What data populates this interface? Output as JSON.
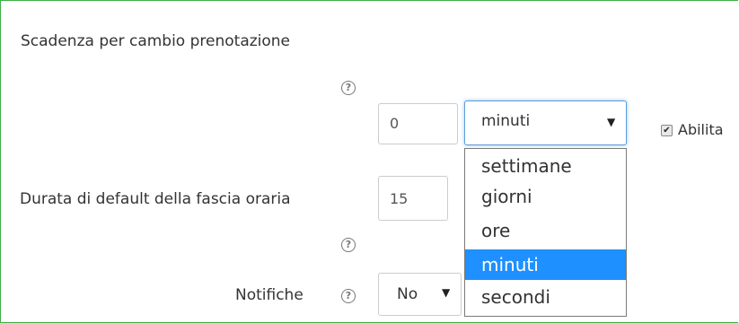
{
  "form": {
    "booking_change_deadline": {
      "label": "Scadenza per cambio prenotazione",
      "value": "0",
      "unit_selected": "minuti",
      "enable_label": "Abilita",
      "enable_checked": true
    },
    "slot_duration": {
      "label": "Durata di default della fascia oraria",
      "value": "15"
    },
    "notifications": {
      "label": "Notifiche",
      "value": "No"
    }
  },
  "dropdown": {
    "options": [
      "settimane",
      "giorni",
      "ore",
      "minuti",
      "secondi"
    ],
    "selected_index": 3
  },
  "icons": {
    "help": "question-circle-icon",
    "arrow": "caret-down-icon",
    "check": "checkmark-icon"
  },
  "colors": {
    "frame_border": "#3fae49",
    "highlight": "#1e90ff",
    "focus_border": "#5b9dd9"
  }
}
